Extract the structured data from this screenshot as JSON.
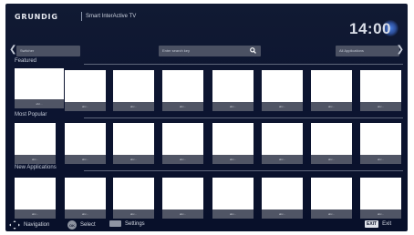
{
  "header": {
    "brand": "GRUNDIG",
    "subtitle": "Smart InterActive TV",
    "clock": "14:00"
  },
  "filter_bar": {
    "left_label": "Switcher",
    "search_placeholder": "Enter search key",
    "right_label": "All Applications"
  },
  "sections": [
    {
      "title": "Featured",
      "tile_caption": "abc...",
      "tile_count": 8
    },
    {
      "title": "Most Popular",
      "tile_caption": "abc...",
      "tile_count": 8
    },
    {
      "title": "New Applications",
      "tile_caption": "abc...",
      "tile_count": 8
    }
  ],
  "footer": {
    "navigation": "Navigation",
    "ok_key": "OK",
    "select": "Select",
    "settings": "Settings",
    "exit_key": "EXIT",
    "exit": "Exit"
  },
  "colors": {
    "background": "#0c1430",
    "tile": "#ffffff",
    "caption_bar": "#505565",
    "clock_glow": "#4a7fe0"
  }
}
